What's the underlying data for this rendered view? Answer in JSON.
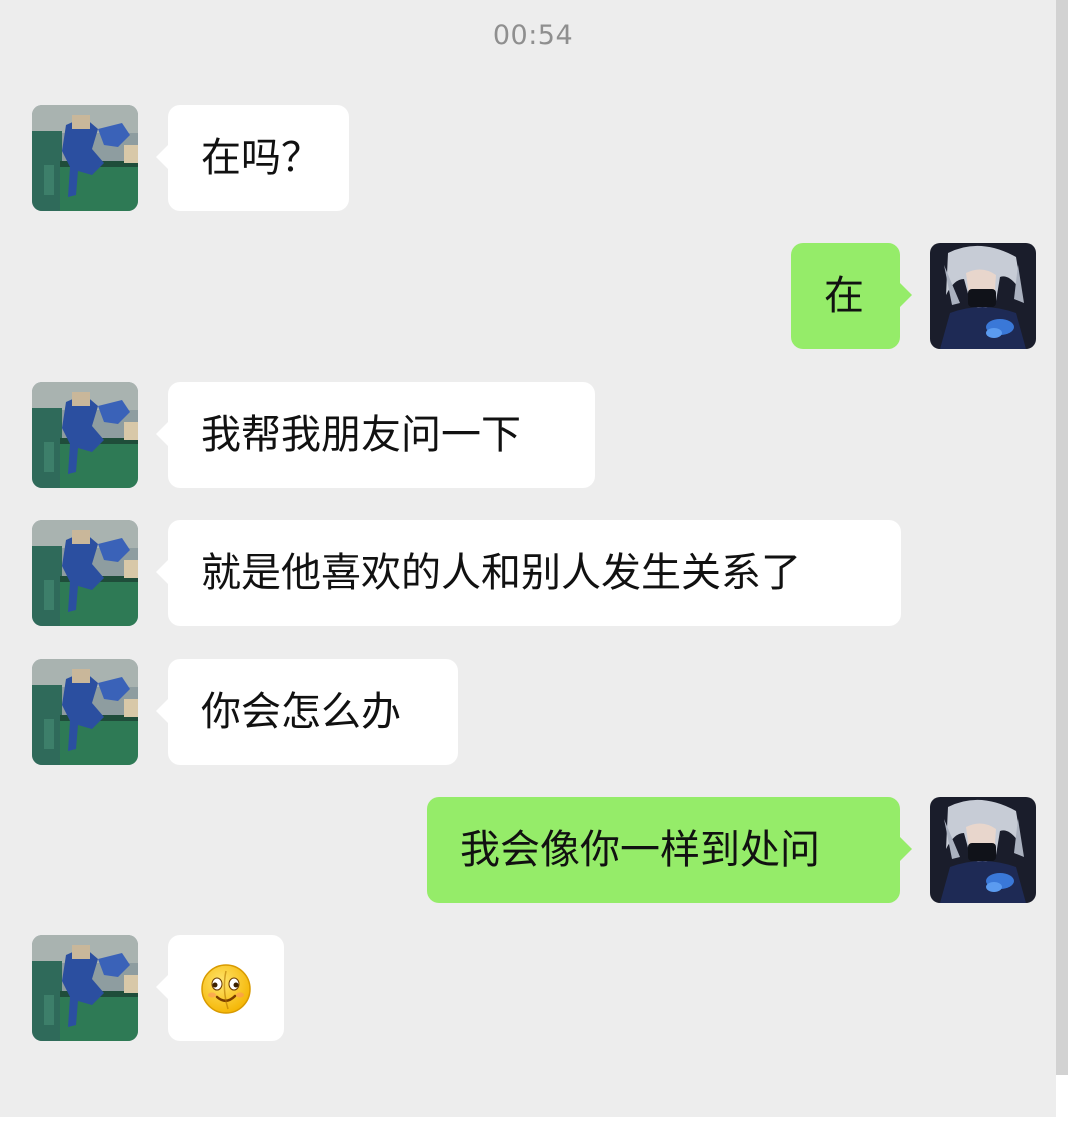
{
  "chat": {
    "timestamp": "00:54",
    "messages": [
      {
        "sender": "friend",
        "text": "在吗？"
      },
      {
        "sender": "me",
        "text": "在"
      },
      {
        "sender": "friend",
        "text": "我帮我朋友问一下"
      },
      {
        "sender": "friend",
        "text": "就是他喜欢的人和别人发生关系了"
      },
      {
        "sender": "friend",
        "text": "你会怎么办"
      },
      {
        "sender": "me",
        "text": "我会像你一样到处问"
      },
      {
        "sender": "friend",
        "emoji": "smirk-face-emoji"
      }
    ]
  },
  "colors": {
    "chat_background": "#ededed",
    "incoming_bubble": "#ffffff",
    "outgoing_bubble": "#95ec69",
    "timestamp_text": "#8f8f8f"
  },
  "avatars": {
    "friend": "friend-avatar-blue-figure",
    "me": "my-avatar-masked-silver-hair"
  }
}
